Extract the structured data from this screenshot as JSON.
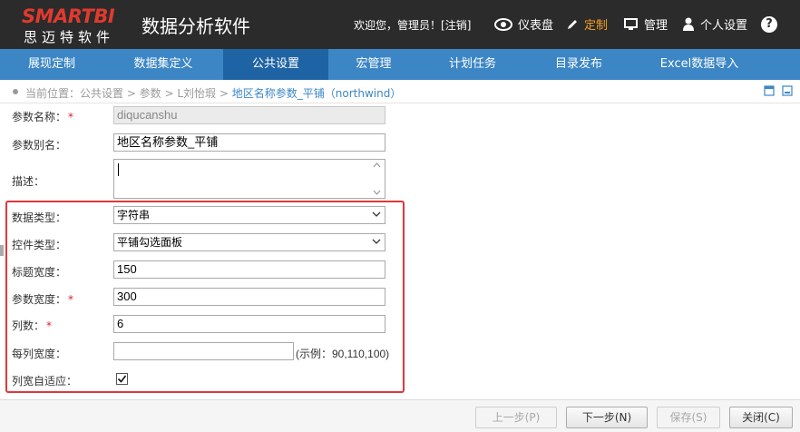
{
  "header": {
    "logo_main": "SMARTBI",
    "logo_sub": "思迈特软件",
    "app_title": "数据分析软件",
    "welcome": "欢迎您，管理员！[",
    "logout": "注销",
    "welcome_end": "]",
    "items": [
      {
        "label": "仪表盘",
        "icon": "eye-icon"
      },
      {
        "label": "定制",
        "icon": "pencil-icon"
      },
      {
        "label": "管理",
        "icon": "monitor-icon"
      },
      {
        "label": "个人设置",
        "icon": "user-icon"
      }
    ],
    "help": "?",
    "active_color": "#f2a024"
  },
  "nav": {
    "tabs": [
      "展现定制",
      "数据集定义",
      "公共设置",
      "宏管理",
      "计划任务",
      "目录发布",
      "Excel数据导入"
    ],
    "active_index": 2
  },
  "breadcrumb": {
    "prefix": "当前位置：公共设置 > 参数 > L刘怡瑕 > ",
    "current": "地区名称参数_平铺（northwind）"
  },
  "form": {
    "param_name_label": "参数名称：",
    "param_name_value": "diqucanshu",
    "param_alias_label": "参数别名：",
    "param_alias_value": "地区名称参数_平铺",
    "desc_label": "描述：",
    "data_type_label": "数据类型：",
    "data_type_value": "字符串",
    "control_type_label": "控件类型：",
    "control_type_value": "平铺勾选面板",
    "title_width_label": "标题宽度：",
    "title_width_value": "150",
    "param_width_label": "参数宽度：",
    "param_width_value": "300",
    "columns_label": "列数：",
    "columns_value": "6",
    "col_width_label": "每列宽度：",
    "col_width_value": "",
    "col_width_hint": "(示例：90,110,100)",
    "auto_fit_label": "列宽自适应：",
    "auto_fit_checked": true,
    "required_mark": "*"
  },
  "buttons": {
    "prev": "上一步(P)",
    "next": "下一步(N)",
    "save": "保存(S)",
    "close": "关闭(C)"
  },
  "colors": {
    "header_bg": "#2b2b2b",
    "nav_bg": "#3c86c5",
    "nav_active": "#1e63a3",
    "highlight": "#e0363a",
    "required": "#d9232e"
  }
}
